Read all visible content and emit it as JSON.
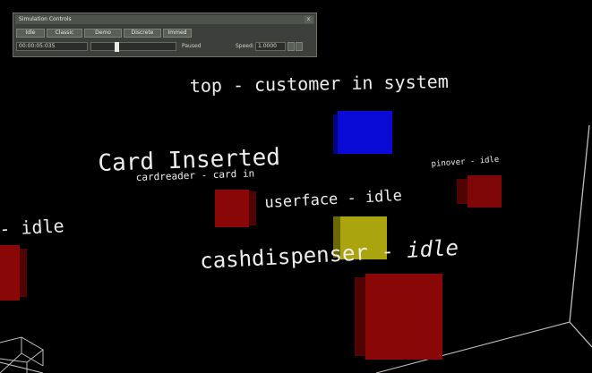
{
  "panel": {
    "title": "Simulation Controls",
    "close": "x",
    "buttons": [
      "Idle",
      "Classic",
      "Demo",
      "Discrete",
      "Immed"
    ],
    "time": "00:00:05:035",
    "status": "Paused",
    "speed_label": "Speed:",
    "speed_value": "1.0000"
  },
  "labels": {
    "top": "top - customer in system",
    "card_inserted": "Card Inserted",
    "cardreader": "cardreader - card in",
    "pinover": "pinover - idle",
    "userface": "userface - idle",
    "idle_left": "- idle",
    "cashdispenser_name": "cashdispenser - ",
    "cashdispenser_state": "idle"
  },
  "colors": {
    "blue_cube": "#0a0ad6",
    "red_cube": "#8a0707",
    "yellow_cube": "#aaa50e",
    "wireframe": "#bfbfbf"
  }
}
